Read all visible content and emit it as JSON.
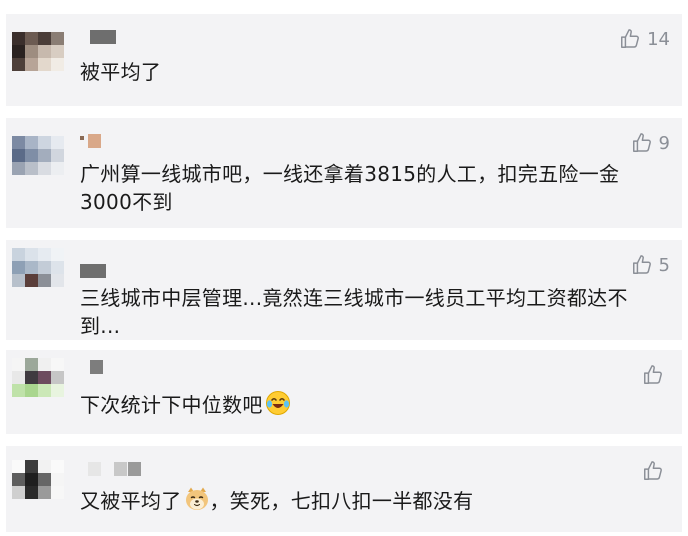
{
  "comments": [
    {
      "text": "被平均了",
      "likes": "14"
    },
    {
      "text": "广州算一线城市吧，一线还拿着3815的人工，扣完五险一金3000不到",
      "likes": "9"
    },
    {
      "text": "三线城市中层管理...竟然连三线城市一线员工平均工资都达不到...",
      "likes": "5"
    },
    {
      "text": "下次统计下中位数吧",
      "likes": "",
      "emoji": "laughing-crying-emoji"
    },
    {
      "text_before": "又被平均了",
      "emoji": "doge-emoji",
      "text_after": "，笑死，七扣八扣一半都没有",
      "likes": ""
    }
  ],
  "icons": {
    "like": "thumbs-up-icon"
  },
  "colors": {
    "card_bg": "#f3f3f5",
    "meta": "#8b8f97",
    "text": "#1a1a1a"
  }
}
